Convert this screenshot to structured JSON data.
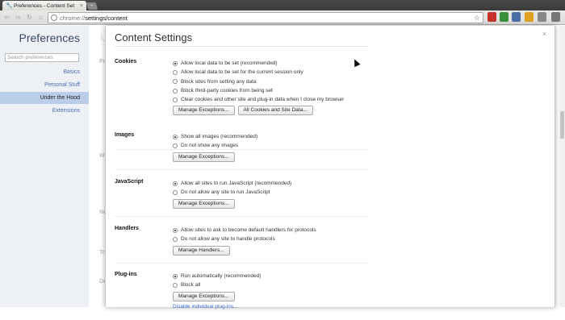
{
  "browser": {
    "tab_title": "Preferences - Content Set",
    "tab_close": "×",
    "newtab_label": "+",
    "url_prefix": "chrome://",
    "url_path": "settings/content",
    "star": "☆",
    "back": "⇦",
    "forward": "⇨",
    "reload": "↻",
    "home": "⌂"
  },
  "sidebar": {
    "title": "Preferences",
    "search_placeholder": "Search preferences",
    "items": [
      {
        "label": "Basics"
      },
      {
        "label": "Personal Stuff"
      },
      {
        "label": "Under the Hood",
        "selected": true
      },
      {
        "label": "Extensions"
      }
    ]
  },
  "background_page": {
    "title": "U",
    "labels": [
      "Pr",
      "Wi",
      "Ne",
      "Tr",
      "Do"
    ]
  },
  "dialog": {
    "title": "Content Settings",
    "close": "×",
    "sections": [
      {
        "label": "Cookies",
        "options": [
          {
            "label": "Allow local data to be set (recommended)",
            "checked": true
          },
          {
            "label": "Allow local data to be set for the current session only",
            "checked": false
          },
          {
            "label": "Block sites from setting any data",
            "checked": false
          },
          {
            "label": "Block third-party cookies from being set",
            "checked": false,
            "type": "checkbox"
          },
          {
            "label": "Clear cookies and other site and plug-in data when I close my browser",
            "checked": false,
            "type": "checkbox"
          }
        ],
        "buttons": [
          "Manage Exceptions...",
          "All Cookies and Site Data..."
        ]
      },
      {
        "label": "Images",
        "options": [
          {
            "label": "Show all images (recommended)",
            "checked": true
          },
          {
            "label": "Do not show any images",
            "checked": false
          }
        ],
        "buttons": [
          "Manage Exceptions..."
        ]
      },
      {
        "label": "JavaScript",
        "options": [
          {
            "label": "Allow all sites to run JavaScript (recommended)",
            "checked": true
          },
          {
            "label": "Do not allow any site to run JavaScript",
            "checked": false
          }
        ],
        "buttons": [
          "Manage Exceptions..."
        ]
      },
      {
        "label": "Handlers",
        "options": [
          {
            "label": "Allow sites to ask to become default handlers for protocols",
            "checked": true
          },
          {
            "label": "Do not allow any site to handle protocols",
            "checked": false
          }
        ],
        "buttons": [
          "Manage Handlers..."
        ]
      },
      {
        "label": "Plug-ins",
        "options": [
          {
            "label": "Run automatically (recommended)",
            "checked": true
          },
          {
            "label": "Block all",
            "checked": false
          }
        ],
        "buttons": [
          "Manage Exceptions..."
        ],
        "link": "Disable individual plug-ins..."
      }
    ]
  },
  "colors": {
    "sidebar_bg": "#edf0f5",
    "sidebar_selected": "#bbcee9",
    "link": "#3366cc"
  }
}
